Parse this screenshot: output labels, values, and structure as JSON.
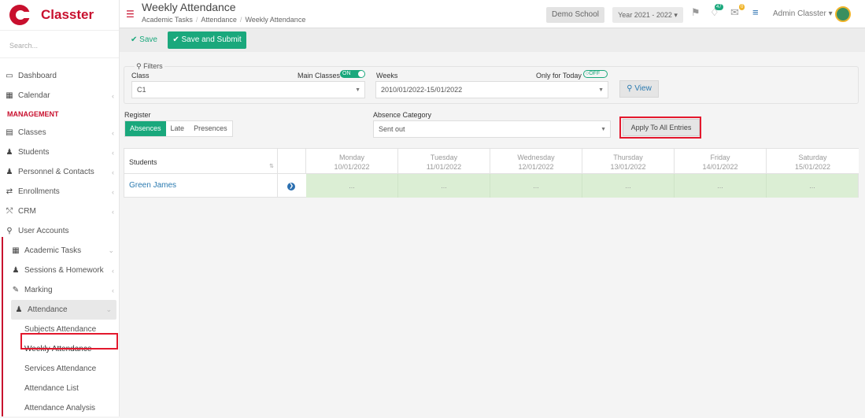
{
  "brand": {
    "name": "Classter"
  },
  "search": {
    "placeholder": "Search..."
  },
  "sidebar": {
    "items": [
      {
        "label": "Dashboard",
        "icon": "monitor-icon"
      },
      {
        "label": "Calendar",
        "icon": "calendar-icon"
      },
      {
        "section": "MANAGEMENT"
      },
      {
        "label": "Classes",
        "icon": "classes-icon"
      },
      {
        "label": "Students",
        "icon": "students-icon"
      },
      {
        "label": "Personnel & Contacts",
        "icon": "personnel-icon"
      },
      {
        "label": "Enrollments",
        "icon": "enrollments-icon"
      },
      {
        "label": "CRM",
        "icon": "crm-icon"
      },
      {
        "label": "User Accounts",
        "icon": "key-icon"
      },
      {
        "label": "Academic Tasks",
        "icon": "grid-icon"
      },
      {
        "label": "Sessions & Homework",
        "icon": "sessions-icon"
      },
      {
        "label": "Marking",
        "icon": "pencil-icon"
      },
      {
        "label": "Attendance",
        "icon": "attendance-icon"
      },
      {
        "label": "Subjects Attendance"
      },
      {
        "label": "Weekly Attendance"
      },
      {
        "label": "Services Attendance"
      },
      {
        "label": "Attendance List"
      },
      {
        "label": "Attendance Analysis"
      }
    ]
  },
  "header": {
    "title": "Weekly Attendance",
    "breadcrumb": [
      "Academic Tasks",
      "Attendance",
      "Weekly Attendance"
    ],
    "school": "Demo School",
    "year": "Year 2021 - 2022 ▾",
    "notif_count": "47",
    "mail_count": "0",
    "user": "Admin Classter ▾"
  },
  "actions": {
    "save": "Save",
    "save_submit": "Save and Submit"
  },
  "filters": {
    "legend": "Filters",
    "class_label": "Class",
    "class_value": "C1",
    "main_classes_label": "Main Classes",
    "main_classes_toggle": "ON",
    "weeks_label": "Weeks",
    "weeks_value": "2010/01/2022-15/01/2022",
    "today_label": "Only for Today",
    "today_toggle": "OFF",
    "view": "View"
  },
  "register": {
    "label": "Register",
    "options": [
      "Absences",
      "Late",
      "Presences"
    ],
    "absence_label": "Absence Category",
    "absence_value": "Sent out",
    "apply": "Apply To All Entries"
  },
  "table": {
    "students_header": "Students",
    "days": [
      {
        "day": "Monday",
        "date": "10/01/2022"
      },
      {
        "day": "Tuesday",
        "date": "11/01/2022"
      },
      {
        "day": "Wednesday",
        "date": "12/01/2022"
      },
      {
        "day": "Thursday",
        "date": "13/01/2022"
      },
      {
        "day": "Friday",
        "date": "14/01/2022"
      },
      {
        "day": "Saturday",
        "date": "15/01/2022"
      }
    ],
    "rows": [
      {
        "name": "Green James",
        "cells": [
          "...",
          "...",
          "...",
          "...",
          "...",
          "..."
        ]
      }
    ]
  }
}
